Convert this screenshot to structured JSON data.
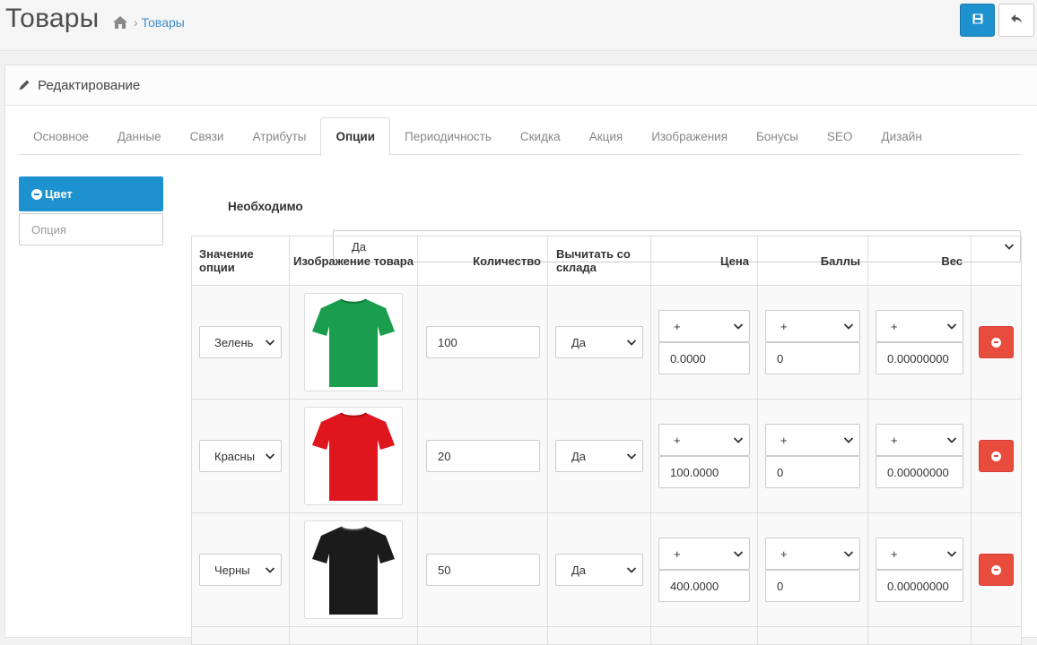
{
  "header": {
    "title": "Товары",
    "breadcrumb": [
      {
        "icon": "home-icon"
      },
      {
        "label": "Товары"
      }
    ],
    "save_icon": "floppy-disk-icon",
    "back_icon": "reply-icon"
  },
  "panel": {
    "title": "Редактирование",
    "icon": "pencil-icon"
  },
  "tabs": [
    "Основное",
    "Данные",
    "Связи",
    "Атрибуты",
    "Опции",
    "Периодичность",
    "Скидка",
    "Акция",
    "Изображения",
    "Бонусы",
    "SEO",
    "Дизайн"
  ],
  "active_tab": "Опции",
  "options": {
    "active_label": "Цвет",
    "input_placeholder": "Опция"
  },
  "required": {
    "label": "Необходимо",
    "value": "Да"
  },
  "table": {
    "headers": {
      "value": "Значение опции",
      "image": "Изображение товара",
      "quantity": "Количество",
      "subtract": "Вычитать со склада",
      "price": "Цена",
      "points": "Баллы",
      "weight": "Вес"
    },
    "rows": [
      {
        "value": "Зелень",
        "shirt_color": "#1a9e4d",
        "quantity": "100",
        "subtract": "Да",
        "price_prefix": "+",
        "price": "0.0000",
        "points_prefix": "+",
        "points": "0",
        "weight_prefix": "+",
        "weight": "0.00000000"
      },
      {
        "value": "Красны",
        "shirt_color": "#e0161f",
        "quantity": "20",
        "subtract": "Да",
        "price_prefix": "+",
        "price": "100.0000",
        "points_prefix": "+",
        "points": "0",
        "weight_prefix": "+",
        "weight": "0.00000000"
      },
      {
        "value": "Черны",
        "shirt_color": "#1b1b1b",
        "quantity": "50",
        "subtract": "Да",
        "price_prefix": "+",
        "price": "400.0000",
        "points_prefix": "+",
        "points": "0",
        "weight_prefix": "+",
        "weight": "0.00000000"
      }
    ]
  },
  "colors": {
    "primary": "#1e91cf",
    "danger": "#e74c3c",
    "link": "#3d8ec9"
  }
}
